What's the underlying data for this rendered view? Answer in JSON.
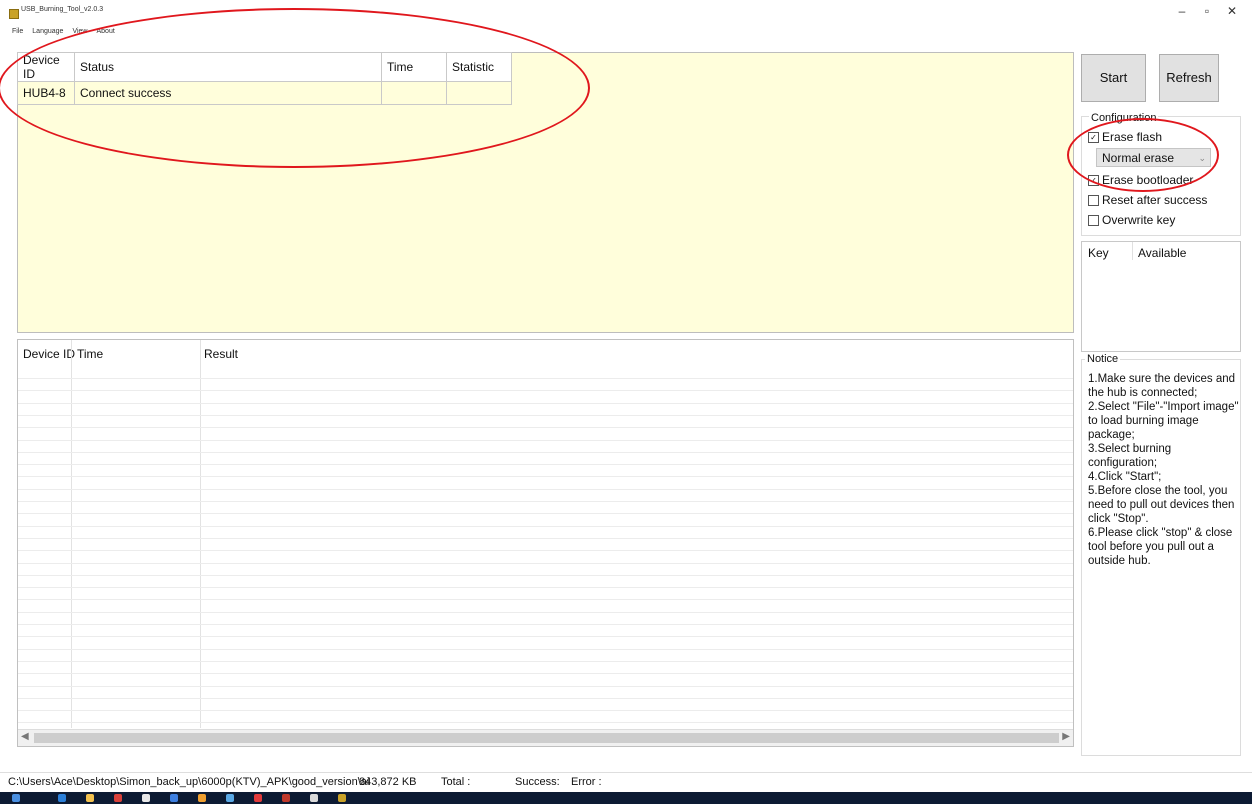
{
  "window": {
    "title": "USB_Burning_Tool_v2.0.3",
    "controls": {
      "minimize": "–",
      "maximize": "▫",
      "close": "✕"
    }
  },
  "menu": [
    "File",
    "Language",
    "View",
    "About"
  ],
  "status_table": {
    "headers": [
      "Device ID",
      "Status",
      "Time",
      "Statistic"
    ],
    "rows": [
      [
        "HUB4-8",
        "Connect success",
        "",
        ""
      ]
    ]
  },
  "result_table": {
    "headers": [
      "Device ID",
      "Time",
      "Result"
    ]
  },
  "buttons": {
    "start": "Start",
    "refresh": "Refresh"
  },
  "configuration": {
    "title": "Configuration",
    "erase_flash": {
      "label": "Erase flash",
      "checked": true
    },
    "erase_mode": "Normal erase",
    "erase_bootloader": {
      "label": "Erase bootloader",
      "checked": true
    },
    "reset_after_success": {
      "label": "Reset after success",
      "checked": false
    },
    "overwrite_key": {
      "label": "Overwrite key",
      "checked": false
    }
  },
  "key_table": {
    "headers": [
      "Key",
      "Available"
    ]
  },
  "notice": {
    "title": "Notice",
    "lines": [
      "1.Make sure the devices and the hub is connected;",
      "2.Select \"File\"-\"Import image\" to load burning image package;",
      "3.Select burning configuration;",
      "4.Click \"Start\";",
      "5.Before close the tool, you need to pull out devices then click \"Stop\".",
      "6.Please click \"stop\" & close tool before you pull out a outside hub."
    ]
  },
  "statusbar": {
    "path": "C:\\Users\\Ace\\Desktop\\Simon_back_up\\6000p(KTV)_APK\\good_version\\ai",
    "size": "843,872 KB",
    "total": "Total :",
    "success": "Success:",
    "error": "Error :"
  },
  "colors": {
    "panel_background": "#fffedb",
    "annotation": "#e0171d",
    "taskbar": "#0d1b33"
  }
}
